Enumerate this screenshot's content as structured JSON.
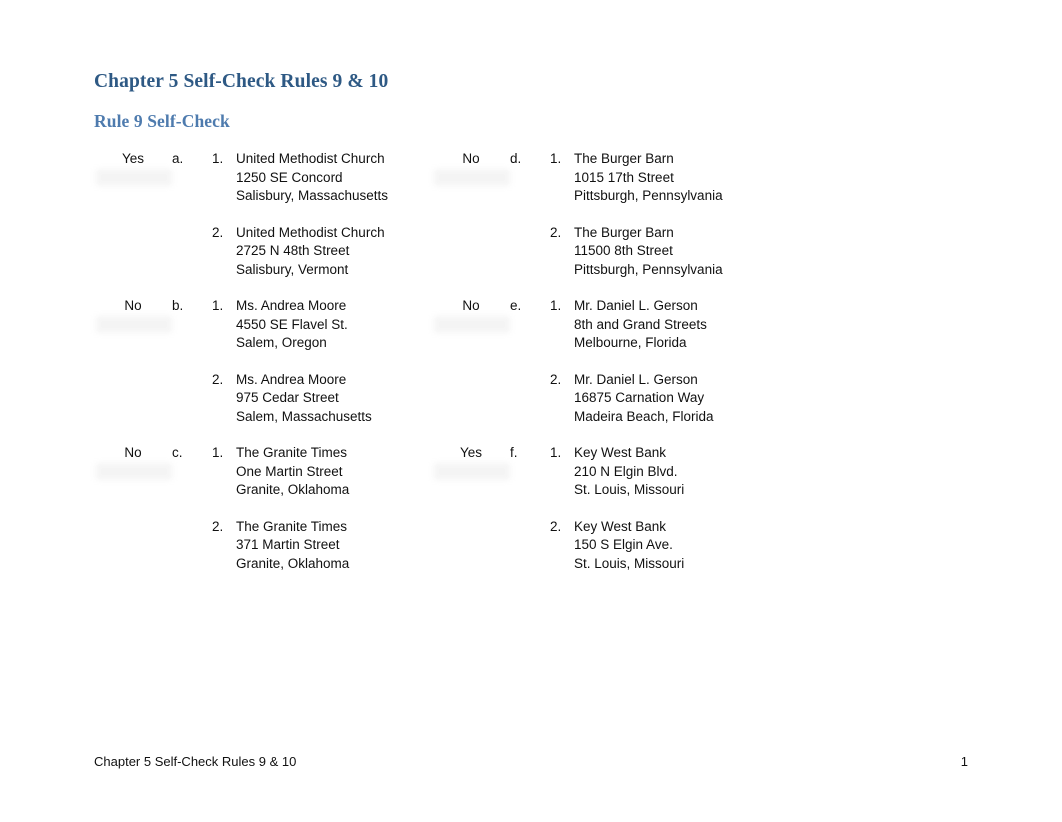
{
  "document": {
    "title": "Chapter 5 Self-Check Rules 9 & 10",
    "section_heading": "Rule 9 Self-Check",
    "title_color": "#2E5984",
    "section_heading_color": "#4E7BAE"
  },
  "footer": {
    "left_text": "Chapter 5 Self-Check Rules 9 & 10",
    "page_number": "1"
  },
  "columns": {
    "left": [
      {
        "answer": "Yes",
        "letter": "a.",
        "items": [
          {
            "number": "1.",
            "lines": [
              "United Methodist Church",
              "1250 SE Concord",
              "Salisbury, Massachusetts"
            ]
          },
          {
            "number": "2.",
            "lines": [
              "United Methodist Church",
              "2725 N 48th Street",
              "Salisbury, Vermont"
            ]
          }
        ]
      },
      {
        "answer": "No",
        "letter": "b.",
        "items": [
          {
            "number": "1.",
            "lines": [
              "Ms. Andrea Moore",
              "4550 SE Flavel St.",
              "Salem, Oregon"
            ]
          },
          {
            "number": "2.",
            "lines": [
              "Ms. Andrea Moore",
              "975 Cedar Street",
              "Salem, Massachusetts"
            ]
          }
        ]
      },
      {
        "answer": "No",
        "letter": "c.",
        "items": [
          {
            "number": "1.",
            "lines": [
              "The Granite Times",
              "One Martin Street",
              "Granite, Oklahoma"
            ]
          },
          {
            "number": "2.",
            "lines": [
              "The Granite Times",
              "371 Martin Street",
              "Granite, Oklahoma"
            ]
          }
        ]
      }
    ],
    "right": [
      {
        "answer": "No",
        "letter": "d.",
        "items": [
          {
            "number": "1.",
            "lines": [
              "The Burger Barn",
              "1015 17th Street",
              "Pittsburgh, Pennsylvania"
            ]
          },
          {
            "number": "2.",
            "lines": [
              "The Burger Barn",
              "11500 8th Street",
              "Pittsburgh, Pennsylvania"
            ]
          }
        ]
      },
      {
        "answer": "No",
        "letter": "e.",
        "items": [
          {
            "number": "1.",
            "lines": [
              "Mr. Daniel L. Gerson",
              "8th and Grand Streets",
              "Melbourne, Florida"
            ]
          },
          {
            "number": "2.",
            "lines": [
              "Mr. Daniel L. Gerson",
              "16875 Carnation Way",
              "Madeira Beach, Florida"
            ]
          }
        ]
      },
      {
        "answer": "Yes",
        "letter": "f.",
        "items": [
          {
            "number": "1.",
            "lines": [
              "Key West Bank",
              "210 N Elgin Blvd.",
              "St. Louis, Missouri"
            ]
          },
          {
            "number": "2.",
            "lines": [
              "Key West Bank",
              "150 S Elgin Ave.",
              "St. Louis, Missouri"
            ]
          }
        ]
      }
    ]
  }
}
